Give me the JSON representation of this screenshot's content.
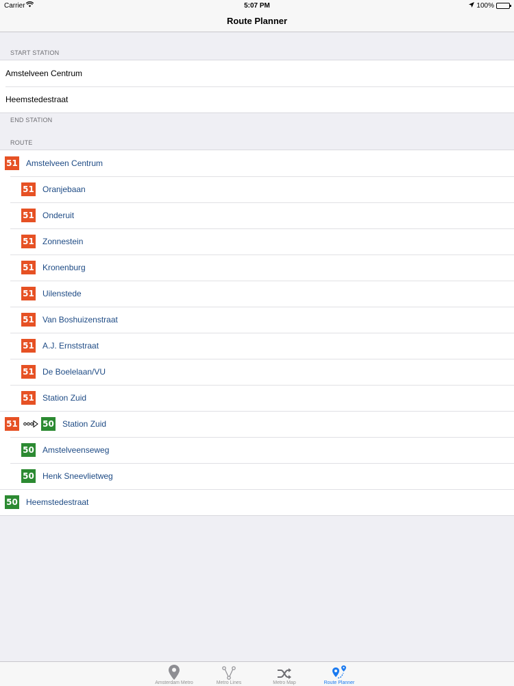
{
  "status_bar": {
    "carrier": "Carrier",
    "time": "5:07 PM",
    "battery": "100%",
    "battery_level": 1.0
  },
  "nav": {
    "title": "Route Planner"
  },
  "start_section": {
    "header": "START STATION",
    "start_value": "Amstelveen Centrum",
    "end_value": "Heemstedestraat"
  },
  "end_section": {
    "header": "END STATION"
  },
  "route_section": {
    "header": "ROUTE",
    "rows": [
      {
        "line": "51",
        "color": "#e65124",
        "station": "Amstelveen Centrum",
        "level": 0
      },
      {
        "line": "51",
        "color": "#e65124",
        "station": "Oranjebaan",
        "level": 1
      },
      {
        "line": "51",
        "color": "#e65124",
        "station": "Onderuit",
        "level": 1
      },
      {
        "line": "51",
        "color": "#e65124",
        "station": "Zonnestein",
        "level": 1
      },
      {
        "line": "51",
        "color": "#e65124",
        "station": "Kronenburg",
        "level": 1
      },
      {
        "line": "51",
        "color": "#e65124",
        "station": "Uilenstede",
        "level": 1
      },
      {
        "line": "51",
        "color": "#e65124",
        "station": "Van Boshuizenstraat",
        "level": 1
      },
      {
        "line": "51",
        "color": "#e65124",
        "station": "A.J. Ernststraat",
        "level": 1
      },
      {
        "line": "51",
        "color": "#e65124",
        "station": "De Boelelaan/VU",
        "level": 1
      },
      {
        "line": "51",
        "color": "#e65124",
        "station": "Station Zuid",
        "level": 1
      },
      {
        "transfer": true,
        "from_line": "51",
        "to_line": "50",
        "station": "Station Zuid",
        "icon": "transfer-arrow-icon"
      },
      {
        "line": "50",
        "color": "#2c8a32",
        "station": "Amstelveenseweg",
        "level": 1
      },
      {
        "line": "50",
        "color": "#2c8a32",
        "station": "Henk Sneevlietweg",
        "level": 1
      },
      {
        "line": "50",
        "color": "#2c8a32",
        "station": "Heemstedestraat",
        "level": 0
      }
    ]
  },
  "tabs": [
    {
      "label": "Amsterdam Metro",
      "icon": "map-pin-icon",
      "active": false
    },
    {
      "label": "Metro Lines",
      "icon": "network-icon",
      "active": false
    },
    {
      "label": "Metro Map",
      "icon": "shuffle-icon",
      "active": false
    },
    {
      "label": "Route Planner",
      "icon": "route-planner-icon",
      "active": true
    }
  ],
  "colors": {
    "line_51": "#e65124",
    "line_50": "#2c8a32",
    "accent": "#1a7af0",
    "station_text": "#1d4a84"
  }
}
